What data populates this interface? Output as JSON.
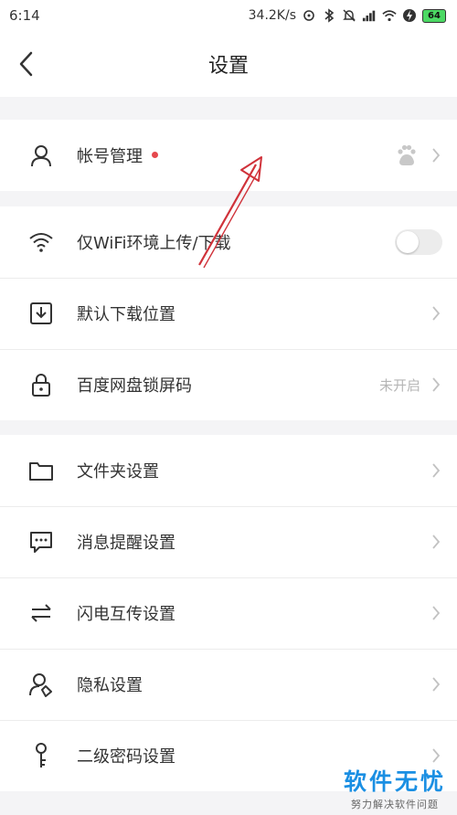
{
  "status_bar": {
    "time": "6:14",
    "network_speed": "34.2K/s",
    "battery": "64"
  },
  "header": {
    "title": "设置"
  },
  "groups": [
    {
      "items": [
        {
          "label": "帐号管理",
          "icon": "user-icon",
          "has_red_dot": true,
          "right_icon": "baidu-paw-icon"
        }
      ]
    },
    {
      "items": [
        {
          "label": "仅WiFi环境上传/下载",
          "icon": "wifi-icon",
          "toggle": "off"
        },
        {
          "label": "默认下载位置",
          "icon": "download-icon"
        },
        {
          "label": "百度网盘锁屏码",
          "icon": "lock-icon",
          "status": "未开启"
        }
      ]
    },
    {
      "items": [
        {
          "label": "文件夹设置",
          "icon": "folder-icon"
        },
        {
          "label": "消息提醒设置",
          "icon": "message-icon"
        },
        {
          "label": "闪电互传设置",
          "icon": "transfer-icon"
        },
        {
          "label": "隐私设置",
          "icon": "privacy-icon"
        },
        {
          "label": "二级密码设置",
          "icon": "key-icon"
        }
      ]
    }
  ],
  "watermark": {
    "main": "软件无忧",
    "sub": "努力解决软件问题"
  },
  "colors": {
    "accent_dot": "#e5484d",
    "annotation_arrow": "#d0323a",
    "watermark": "#1a8fe3"
  }
}
